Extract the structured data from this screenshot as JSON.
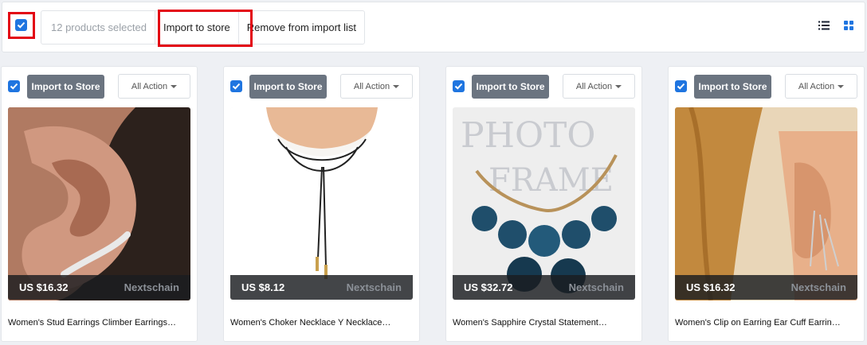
{
  "toolbar": {
    "selected_label": "12 products selected",
    "import_label": "Import to store",
    "remove_label": "Remove from import list",
    "list_view_icon": "list-icon",
    "grid_view_icon": "grid-icon"
  },
  "colors": {
    "highlight": "#e30613",
    "checkbox": "#1f75e0",
    "import_button": "#6b7480",
    "grid_active": "#1f75e0"
  },
  "products": [
    {
      "import_label": "Import to Store",
      "action_label": "All Action",
      "price": "US $16.32",
      "vendor": "Nextschain",
      "title": "Women's Stud Earrings Climber Earrings…",
      "checked": true
    },
    {
      "import_label": "Import to Store",
      "action_label": "All Action",
      "price": "US $8.12",
      "vendor": "Nextschain",
      "title": "Women's Choker Necklace Y Necklace…",
      "checked": true
    },
    {
      "import_label": "Import to Store",
      "action_label": "All Action",
      "price": "US $32.72",
      "vendor": "Nextschain",
      "title": "Women's Sapphire Crystal Statement…",
      "checked": true
    },
    {
      "import_label": "Import to Store",
      "action_label": "All Action",
      "price": "US $16.32",
      "vendor": "Nextschain",
      "title": "Women's Clip on Earring Ear Cuff Earrin…",
      "checked": true
    }
  ]
}
